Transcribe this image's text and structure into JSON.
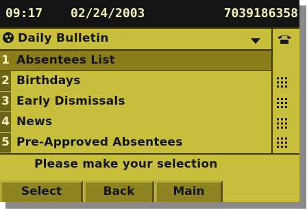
{
  "status": {
    "time": "09:17",
    "date": "02/24/2003",
    "number": "7039186358"
  },
  "header": {
    "title": "Daily Bulletin",
    "icons": [
      "globe-icon",
      "chevron-down-icon",
      "phone-icon"
    ]
  },
  "menu": {
    "items": [
      {
        "index": "1",
        "label": "Absentees List",
        "selected": true
      },
      {
        "index": "2",
        "label": "Birthdays"
      },
      {
        "index": "3",
        "label": "Early Dismissals"
      },
      {
        "index": "4",
        "label": "News"
      },
      {
        "index": "5",
        "label": "Pre-Approved Absentees"
      }
    ]
  },
  "prompt": "Please make your selection",
  "softkeys": {
    "select": "Select",
    "back": "Back",
    "main": "Main"
  },
  "colors": {
    "screen": "#c8bf3c",
    "selected": "#8a7e1c",
    "statusbar": "#141414",
    "softkey": "#8e8321"
  }
}
